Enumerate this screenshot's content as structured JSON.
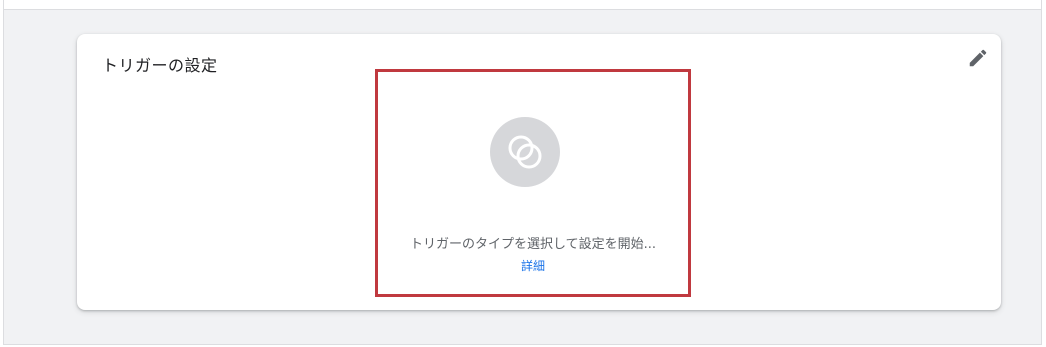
{
  "card": {
    "title": "トリガーの設定",
    "edit_icon": "pencil-icon"
  },
  "trigger_placeholder": {
    "icon": "trigger-circles-icon",
    "text": "トリガーのタイプを選択して設定を開始...",
    "details_link": "詳細"
  },
  "colors": {
    "highlight_border": "#c0393f",
    "link": "#1a73e8",
    "icon_background": "#d6d7da",
    "panel_background": "#f1f2f4"
  }
}
